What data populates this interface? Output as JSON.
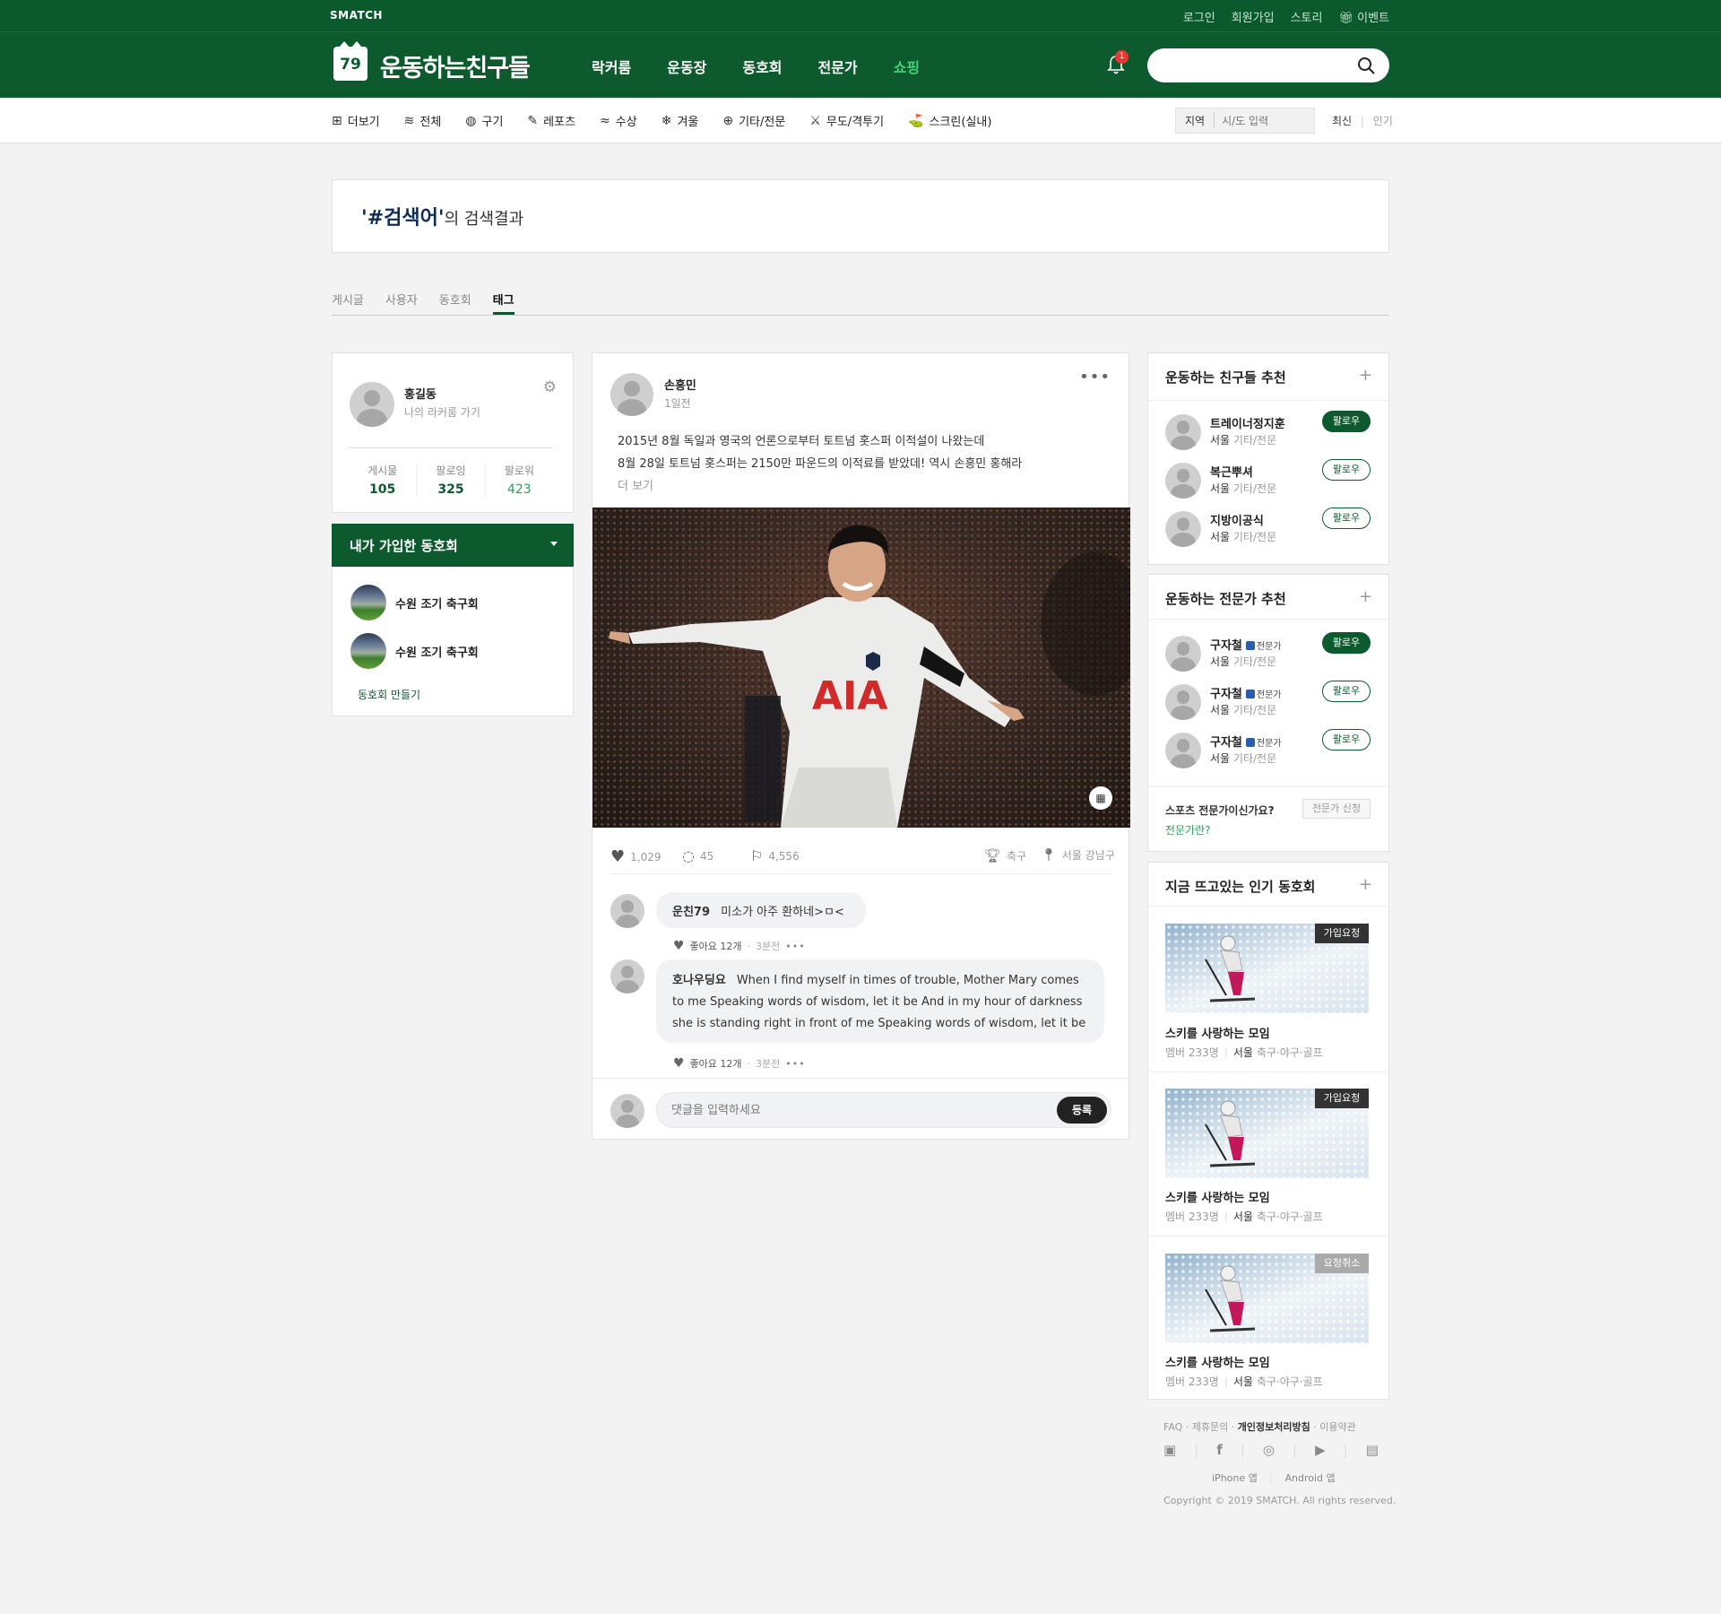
{
  "topbar": {
    "brand": "SMATCH",
    "links": [
      "로그인",
      "회원가입",
      "스토리",
      "이벤트"
    ]
  },
  "header": {
    "logo_number": "79",
    "logo_text": "운동하는친구들",
    "nav": [
      "락커룸",
      "운동장",
      "동호회",
      "전문가",
      "쇼핑"
    ],
    "notification_count": "1",
    "search_placeholder": ""
  },
  "categories": [
    {
      "label": "더보기",
      "icon": "plus-square-icon"
    },
    {
      "label": "전체",
      "icon": "layers-icon"
    },
    {
      "label": "구기",
      "icon": "ball-icon"
    },
    {
      "label": "레포츠",
      "icon": "shuttlecock-icon"
    },
    {
      "label": "수상",
      "icon": "swim-icon"
    },
    {
      "label": "겨울",
      "icon": "snowflake-icon"
    },
    {
      "label": "기타/전문",
      "icon": "target-icon"
    },
    {
      "label": "무도/격투기",
      "icon": "swords-icon"
    },
    {
      "label": "스크린(실내)",
      "icon": "golf-icon"
    }
  ],
  "region": {
    "label": "지역",
    "placeholder": "시/도 입력"
  },
  "sort": {
    "latest": "최신",
    "popular": "인기"
  },
  "search_result": {
    "keyword": "'#검색어'",
    "suffix": "의 검색결과"
  },
  "tabs": [
    "게시글",
    "사용자",
    "동호회",
    "태그"
  ],
  "profile": {
    "name": "홍길동",
    "sub": "나의 라커룸 가기",
    "stats": [
      {
        "label": "게시물",
        "value": "105"
      },
      {
        "label": "팔로잉",
        "value": "325"
      },
      {
        "label": "팔로워",
        "value": "423"
      }
    ]
  },
  "my_clubs": {
    "title": "내가 가입한 동호회",
    "items": [
      "수원 조기 축구회",
      "수원 조기 축구회"
    ],
    "create": "동호회 만들기"
  },
  "post": {
    "author": "손흥민",
    "time": "1일전",
    "text_line1": "2015년 8월 독일과 영국의 언론으로부터 토트넘 홋스퍼 이적설이 나왔는데",
    "text_line2": "8월 28일 토트넘 홋스퍼는 2150만 파운드의 이적료를 받았데! 역시 손흥민 홍해라",
    "more": "더 보기",
    "photo_jersey_text": "AIA",
    "likes": "1,029",
    "comments": "45",
    "bookmarks": "4,556",
    "sport": "축구",
    "location": "서울 강남구",
    "comment_list": [
      {
        "user": "운친79",
        "text": "미소가 아주 환하네>ㅁ<",
        "likes": "좋아요 12개",
        "time": "3분전"
      },
      {
        "user": "호나우딩요",
        "text_line1": "When I find myself in times of trouble, Mother Mary comes",
        "text_line2": "to me Speaking words of wisdom, let it be And in my hour of darkness",
        "text_line3": "she is standing right in front of me Speaking words of wisdom, let it be",
        "likes": "좋아요 12개",
        "time": "3분전"
      }
    ],
    "comment_placeholder": "댓글을 입력하세요",
    "submit": "등록"
  },
  "friends_recommend": {
    "title": "운동하는 친구들 추천",
    "people": [
      {
        "name": "트레이너정지훈",
        "city": "서울",
        "cat": "기타/전문",
        "follow": "팔로우",
        "following": true
      },
      {
        "name": "복근뿌셔",
        "city": "서울",
        "cat": "기타/전문",
        "follow": "팔로우",
        "following": false
      },
      {
        "name": "지방이공식",
        "city": "서울",
        "cat": "기타/전문",
        "follow": "팔로우",
        "following": false
      }
    ]
  },
  "expert_recommend": {
    "title": "운동하는 전문가 추천",
    "badge": "전문가",
    "people": [
      {
        "name": "구자철",
        "city": "서울",
        "cat": "기타/전문",
        "follow": "팔로우",
        "following": true
      },
      {
        "name": "구자철",
        "city": "서울",
        "cat": "기타/전문",
        "follow": "팔로우",
        "following": false
      },
      {
        "name": "구자철",
        "city": "서울",
        "cat": "기타/전문",
        "follow": "팔로우",
        "following": false
      }
    ],
    "question": "스포츠 전문가이신가요?",
    "apply": "전문가 신청",
    "what": "전문가란?"
  },
  "popular_clubs": {
    "title": "지금 뜨고있는 인기 동호회",
    "items": [
      {
        "tag": "가입요청",
        "name": "스키를 사랑하는 모임",
        "members": "멤버 233명",
        "city": "서울",
        "sports": "축구·야구·골프"
      },
      {
        "tag": "가입요청",
        "name": "스키를 사랑하는 모임",
        "members": "멤버 233명",
        "city": "서울",
        "sports": "축구·야구·골프"
      },
      {
        "tag": "요청취소",
        "name": "스키를 사랑하는 모임",
        "members": "멤버 233명",
        "city": "서울",
        "sports": "축구·야구·골프"
      }
    ]
  },
  "footer": {
    "links": [
      "FAQ",
      "제휴문의",
      "개인정보처리방침",
      "이용약관"
    ],
    "apps": [
      "iPhone 앱",
      "Android 앱"
    ],
    "copyright": "Copyright © 2019 SMATCH. All rights reserved."
  },
  "colors": {
    "brand_green": "#0c5a2e",
    "accent_green": "#3fd47a",
    "badge_red": "#e53935"
  }
}
